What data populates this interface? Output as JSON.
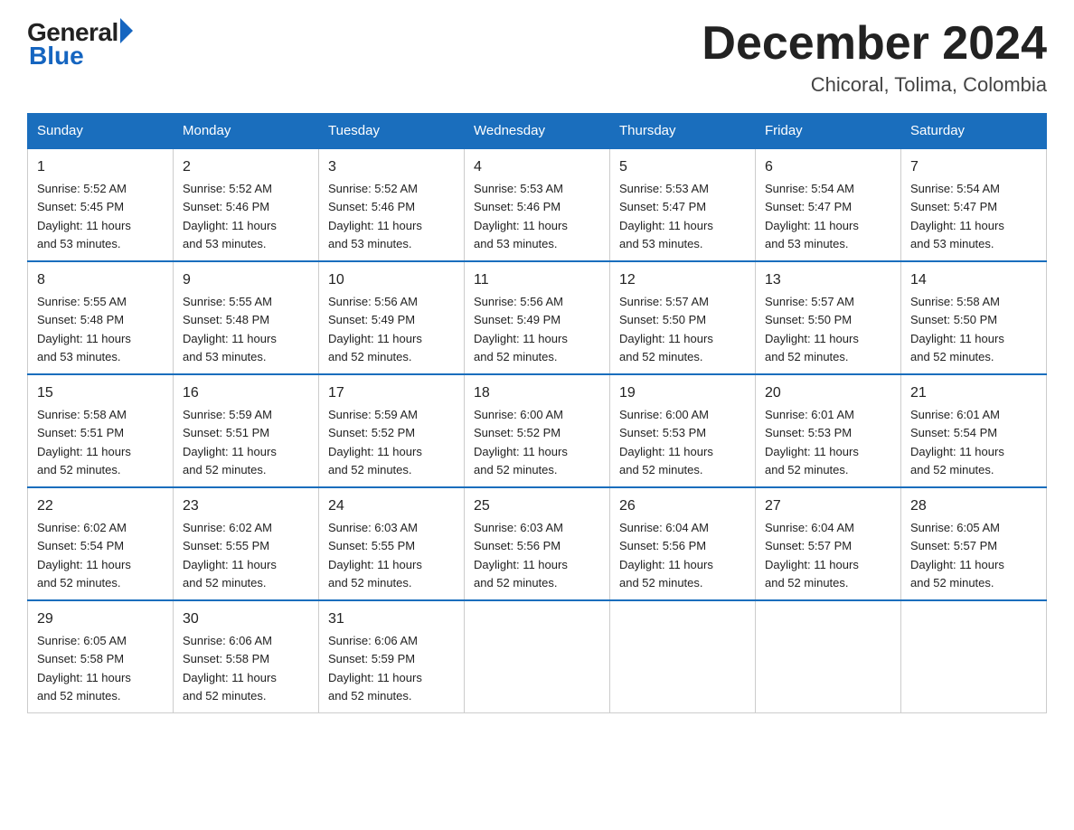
{
  "logo": {
    "general": "General",
    "blue": "Blue"
  },
  "header": {
    "month": "December 2024",
    "location": "Chicoral, Tolima, Colombia"
  },
  "days_of_week": [
    "Sunday",
    "Monday",
    "Tuesday",
    "Wednesday",
    "Thursday",
    "Friday",
    "Saturday"
  ],
  "weeks": [
    [
      {
        "day": "1",
        "sunrise": "5:52 AM",
        "sunset": "5:45 PM",
        "daylight": "11 hours and 53 minutes."
      },
      {
        "day": "2",
        "sunrise": "5:52 AM",
        "sunset": "5:46 PM",
        "daylight": "11 hours and 53 minutes."
      },
      {
        "day": "3",
        "sunrise": "5:52 AM",
        "sunset": "5:46 PM",
        "daylight": "11 hours and 53 minutes."
      },
      {
        "day": "4",
        "sunrise": "5:53 AM",
        "sunset": "5:46 PM",
        "daylight": "11 hours and 53 minutes."
      },
      {
        "day": "5",
        "sunrise": "5:53 AM",
        "sunset": "5:47 PM",
        "daylight": "11 hours and 53 minutes."
      },
      {
        "day": "6",
        "sunrise": "5:54 AM",
        "sunset": "5:47 PM",
        "daylight": "11 hours and 53 minutes."
      },
      {
        "day": "7",
        "sunrise": "5:54 AM",
        "sunset": "5:47 PM",
        "daylight": "11 hours and 53 minutes."
      }
    ],
    [
      {
        "day": "8",
        "sunrise": "5:55 AM",
        "sunset": "5:48 PM",
        "daylight": "11 hours and 53 minutes."
      },
      {
        "day": "9",
        "sunrise": "5:55 AM",
        "sunset": "5:48 PM",
        "daylight": "11 hours and 53 minutes."
      },
      {
        "day": "10",
        "sunrise": "5:56 AM",
        "sunset": "5:49 PM",
        "daylight": "11 hours and 52 minutes."
      },
      {
        "day": "11",
        "sunrise": "5:56 AM",
        "sunset": "5:49 PM",
        "daylight": "11 hours and 52 minutes."
      },
      {
        "day": "12",
        "sunrise": "5:57 AM",
        "sunset": "5:50 PM",
        "daylight": "11 hours and 52 minutes."
      },
      {
        "day": "13",
        "sunrise": "5:57 AM",
        "sunset": "5:50 PM",
        "daylight": "11 hours and 52 minutes."
      },
      {
        "day": "14",
        "sunrise": "5:58 AM",
        "sunset": "5:50 PM",
        "daylight": "11 hours and 52 minutes."
      }
    ],
    [
      {
        "day": "15",
        "sunrise": "5:58 AM",
        "sunset": "5:51 PM",
        "daylight": "11 hours and 52 minutes."
      },
      {
        "day": "16",
        "sunrise": "5:59 AM",
        "sunset": "5:51 PM",
        "daylight": "11 hours and 52 minutes."
      },
      {
        "day": "17",
        "sunrise": "5:59 AM",
        "sunset": "5:52 PM",
        "daylight": "11 hours and 52 minutes."
      },
      {
        "day": "18",
        "sunrise": "6:00 AM",
        "sunset": "5:52 PM",
        "daylight": "11 hours and 52 minutes."
      },
      {
        "day": "19",
        "sunrise": "6:00 AM",
        "sunset": "5:53 PM",
        "daylight": "11 hours and 52 minutes."
      },
      {
        "day": "20",
        "sunrise": "6:01 AM",
        "sunset": "5:53 PM",
        "daylight": "11 hours and 52 minutes."
      },
      {
        "day": "21",
        "sunrise": "6:01 AM",
        "sunset": "5:54 PM",
        "daylight": "11 hours and 52 minutes."
      }
    ],
    [
      {
        "day": "22",
        "sunrise": "6:02 AM",
        "sunset": "5:54 PM",
        "daylight": "11 hours and 52 minutes."
      },
      {
        "day": "23",
        "sunrise": "6:02 AM",
        "sunset": "5:55 PM",
        "daylight": "11 hours and 52 minutes."
      },
      {
        "day": "24",
        "sunrise": "6:03 AM",
        "sunset": "5:55 PM",
        "daylight": "11 hours and 52 minutes."
      },
      {
        "day": "25",
        "sunrise": "6:03 AM",
        "sunset": "5:56 PM",
        "daylight": "11 hours and 52 minutes."
      },
      {
        "day": "26",
        "sunrise": "6:04 AM",
        "sunset": "5:56 PM",
        "daylight": "11 hours and 52 minutes."
      },
      {
        "day": "27",
        "sunrise": "6:04 AM",
        "sunset": "5:57 PM",
        "daylight": "11 hours and 52 minutes."
      },
      {
        "day": "28",
        "sunrise": "6:05 AM",
        "sunset": "5:57 PM",
        "daylight": "11 hours and 52 minutes."
      }
    ],
    [
      {
        "day": "29",
        "sunrise": "6:05 AM",
        "sunset": "5:58 PM",
        "daylight": "11 hours and 52 minutes."
      },
      {
        "day": "30",
        "sunrise": "6:06 AM",
        "sunset": "5:58 PM",
        "daylight": "11 hours and 52 minutes."
      },
      {
        "day": "31",
        "sunrise": "6:06 AM",
        "sunset": "5:59 PM",
        "daylight": "11 hours and 52 minutes."
      },
      null,
      null,
      null,
      null
    ]
  ],
  "labels": {
    "sunrise": "Sunrise:",
    "sunset": "Sunset:",
    "daylight": "Daylight:"
  }
}
